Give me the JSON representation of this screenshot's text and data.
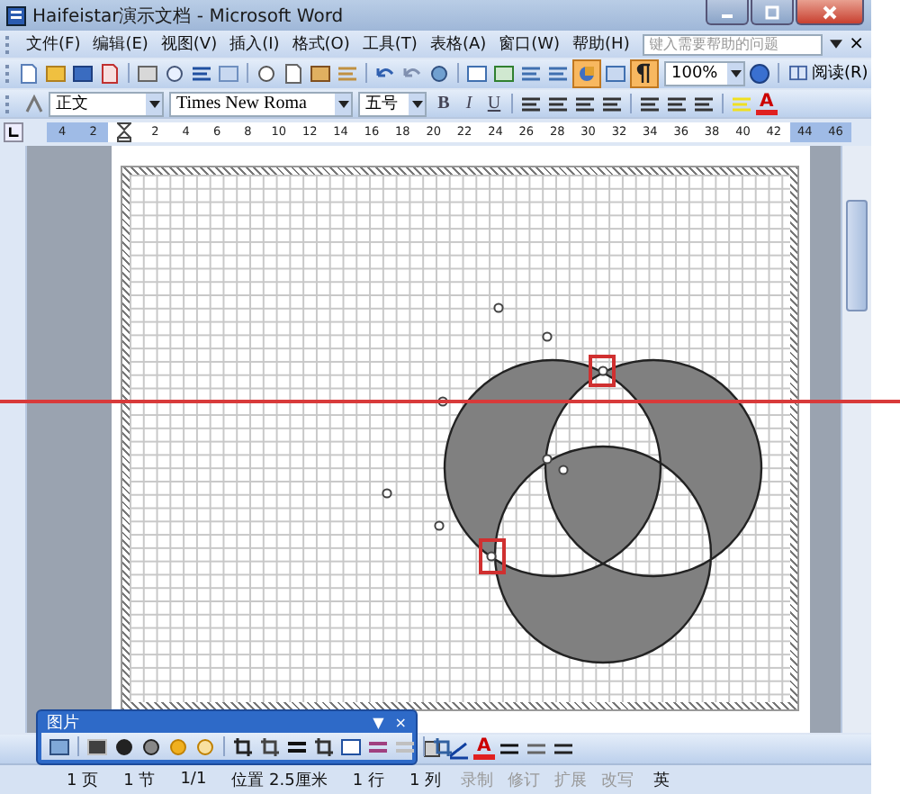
{
  "window": {
    "title": "Haifeistar演示文档 - Microsoft Word"
  },
  "menu": [
    "文件(F)",
    "编辑(E)",
    "视图(V)",
    "插入(I)",
    "格式(O)",
    "工具(T)",
    "表格(A)",
    "窗口(W)",
    "帮助(H)"
  ],
  "help_box": {
    "placeholder": "键入需要帮助的问题",
    "close": "×"
  },
  "standard_toolbar": {
    "zoom": "100%",
    "read_button": "阅读(R)",
    "drawing_pressed": true,
    "grid_pressed": true
  },
  "formatting_toolbar": {
    "style": "正文",
    "font": "Times New Roma",
    "size": "五号",
    "buttons": [
      "B",
      "I",
      "U"
    ],
    "font_color": "A"
  },
  "ruler": [
    {
      "label": "4",
      "margin": true
    },
    {
      "label": "2",
      "margin": true
    },
    {
      "margin": false
    },
    {
      "label": "2",
      "margin": false
    },
    {
      "label": "4",
      "margin": false
    },
    {
      "label": "6",
      "margin": false
    },
    {
      "label": "8",
      "margin": false
    },
    {
      "label": "10",
      "margin": false
    },
    {
      "label": "12",
      "margin": false
    },
    {
      "label": "14",
      "margin": false
    },
    {
      "label": "16",
      "margin": false
    },
    {
      "label": "18",
      "margin": false
    },
    {
      "label": "20",
      "margin": false
    },
    {
      "label": "22",
      "margin": false
    },
    {
      "label": "24",
      "margin": false
    },
    {
      "label": "26",
      "margin": false
    },
    {
      "label": "28",
      "margin": false
    },
    {
      "label": "30",
      "margin": false
    },
    {
      "label": "32",
      "margin": false
    },
    {
      "label": "34",
      "margin": false
    },
    {
      "label": "36",
      "margin": false
    },
    {
      "label": "38",
      "margin": false
    },
    {
      "label": "40",
      "margin": false
    },
    {
      "label": "42",
      "margin": false
    },
    {
      "label": "44",
      "margin": true
    },
    {
      "label": "46",
      "margin": true
    }
  ],
  "picture_toolbar": {
    "title": "图片",
    "menu": "▼",
    "close": "×"
  },
  "drawing_toolbar": {
    "font_color": "A"
  },
  "status_bar": [
    {
      "text": "1 页",
      "disabled": false
    },
    {
      "text": "1 节",
      "disabled": false
    },
    {
      "text": "1/1",
      "disabled": false
    },
    {
      "text": "位置 2.5厘米",
      "disabled": false
    },
    {
      "text": "1 行",
      "disabled": false
    },
    {
      "text": "1 列",
      "disabled": false
    },
    {
      "text": "录制",
      "disabled": true
    },
    {
      "text": "修订",
      "disabled": true
    },
    {
      "text": "扩展",
      "disabled": true
    },
    {
      "text": "改写",
      "disabled": true
    },
    {
      "text": "英",
      "disabled": false
    }
  ]
}
